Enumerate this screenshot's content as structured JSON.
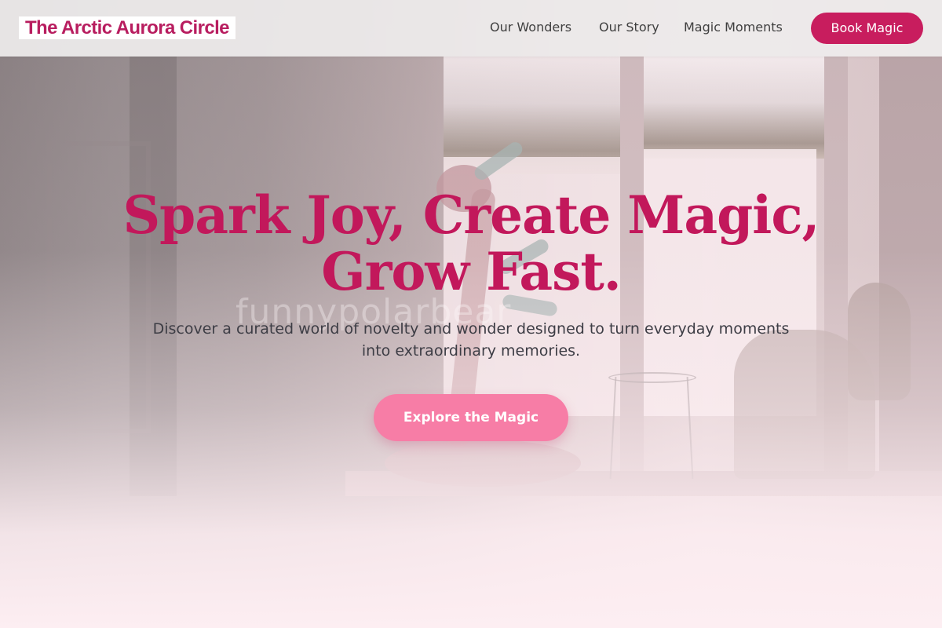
{
  "brand": {
    "name": "The Arctic Aurora Circle",
    "color": "#b81d5f"
  },
  "nav": {
    "items": [
      {
        "label": "Our Wonders"
      },
      {
        "label": "Our Story"
      },
      {
        "label": "Magic Moments"
      }
    ],
    "cta_label": "Book Magic",
    "cta_color": "#c81d5e"
  },
  "hero": {
    "title_line1": "Spark Joy, Create Magic,",
    "title_line2": "Grow Fast.",
    "subtitle_line1": "Discover a curated world of novelty and wonder designed to turn everyday moments",
    "subtitle_line2": "into extraordinary memories.",
    "button_label": "Explore the Magic",
    "title_color": "#c2185b",
    "button_color": "#f77da6",
    "background_image": "photo of a windowsill with a pink abstract sculpture and an elephant bookend",
    "watermark": "funnypolarbear"
  }
}
